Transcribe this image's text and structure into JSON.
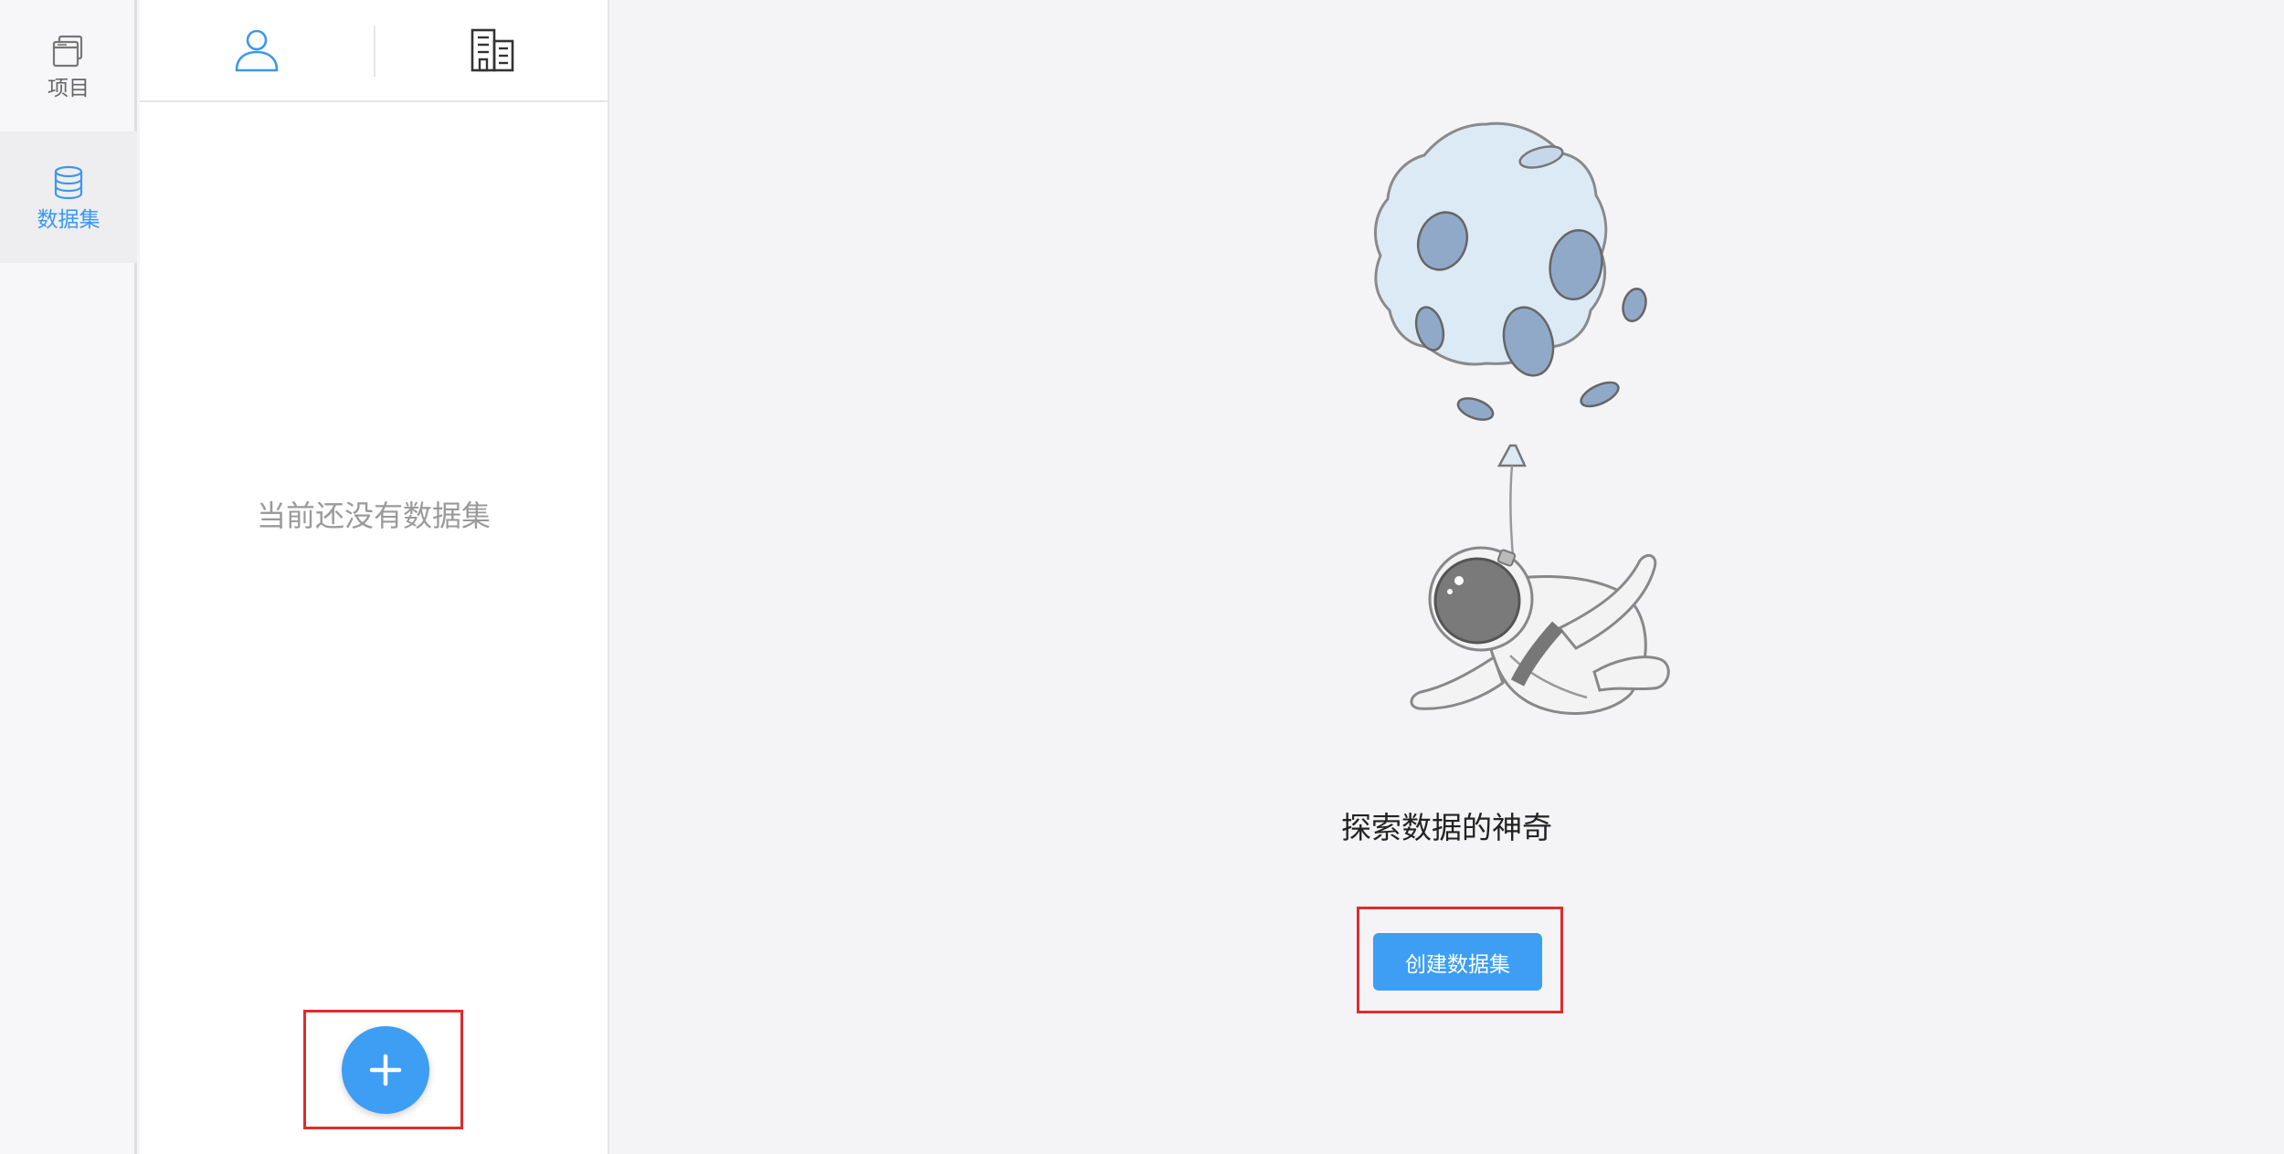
{
  "nav": {
    "items": [
      {
        "label": "项目",
        "icon": "project-stack-icon",
        "active": false
      },
      {
        "label": "数据集",
        "icon": "database-icon",
        "active": true
      }
    ]
  },
  "list_panel": {
    "tabs": [
      {
        "icon": "user-icon",
        "active": true
      },
      {
        "icon": "building-icon",
        "active": false
      }
    ],
    "empty_text": "当前还没有数据集",
    "add_button_icon": "plus-icon"
  },
  "main": {
    "illustration": "astronaut-balloon-illustration",
    "headline": "探索数据的神奇",
    "create_button_label": "创建数据集"
  },
  "colors": {
    "accent": "#3d9ef3",
    "highlight_box": "#e02b2b",
    "active_nav_text": "#3d97ee"
  }
}
